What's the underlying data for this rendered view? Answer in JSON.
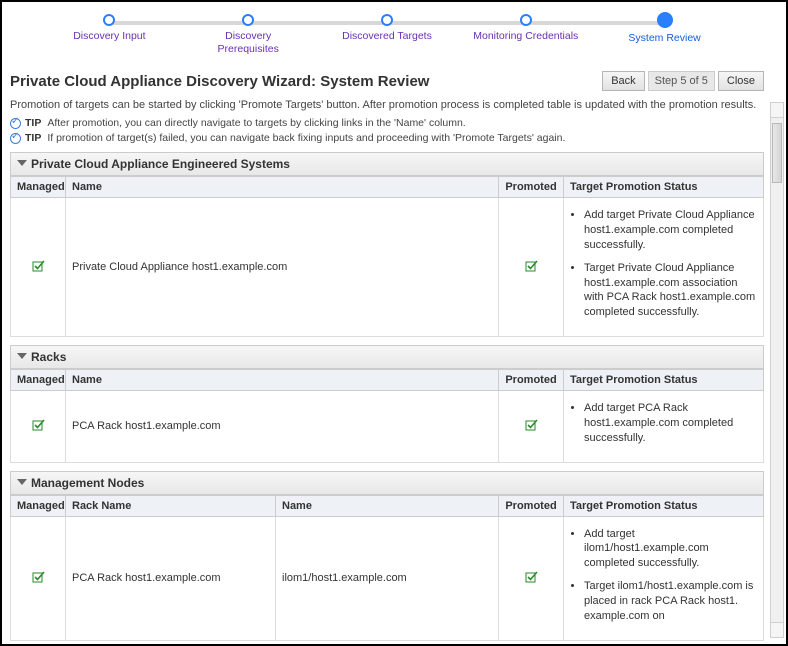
{
  "wizard": {
    "steps": [
      {
        "label": "Discovery Input"
      },
      {
        "label": "Discovery Prerequisites"
      },
      {
        "label": "Discovered Targets"
      },
      {
        "label": "Monitoring Credentials"
      },
      {
        "label": "System Review"
      }
    ],
    "active_index": 4
  },
  "page_title": "Private Cloud Appliance Discovery Wizard: System Review",
  "buttons": {
    "back": "Back",
    "step_counter": "Step 5 of 5",
    "close": "Close"
  },
  "intro": "Promotion of targets can be started by clicking 'Promote Targets' button. After promotion process is completed table is updated with the promotion results.",
  "tips": [
    "After promotion, you can directly navigate to targets by clicking links in the 'Name' column.",
    "If promotion of target(s) failed, you can navigate back fixing inputs and proceeding with 'Promote Targets' again."
  ],
  "tip_label": "TIP",
  "columns": {
    "managed": "Managed",
    "name": "Name",
    "rack_name": "Rack Name",
    "promoted": "Promoted",
    "status": "Target Promotion Status"
  },
  "sections": {
    "pca": {
      "title": "Private Cloud Appliance Engineered Systems",
      "rows": [
        {
          "name": "Private Cloud Appliance  host1.example.com",
          "status": [
            "Add target Private Cloud Appliance host1.example.com completed successfully.",
            "Target Private Cloud Appliance host1.example.com association with PCA Rack host1.example.com completed successfully."
          ]
        }
      ]
    },
    "racks": {
      "title": "Racks",
      "rows": [
        {
          "name": "PCA Rack  host1.example.com",
          "status": [
            "Add target PCA Rack host1.example.com completed successfully."
          ]
        }
      ]
    },
    "mgmt": {
      "title": "Management Nodes",
      "rows": [
        {
          "rack_name": "PCA Rack host1.example.com",
          "name": "ilom1/host1.example.com",
          "status": [
            "Add target ilom1/host1.example.com completed successfully.",
            "Target  ilom1/host1.example.com is placed in rack PCA Rack host1. example.com on"
          ]
        }
      ]
    }
  }
}
